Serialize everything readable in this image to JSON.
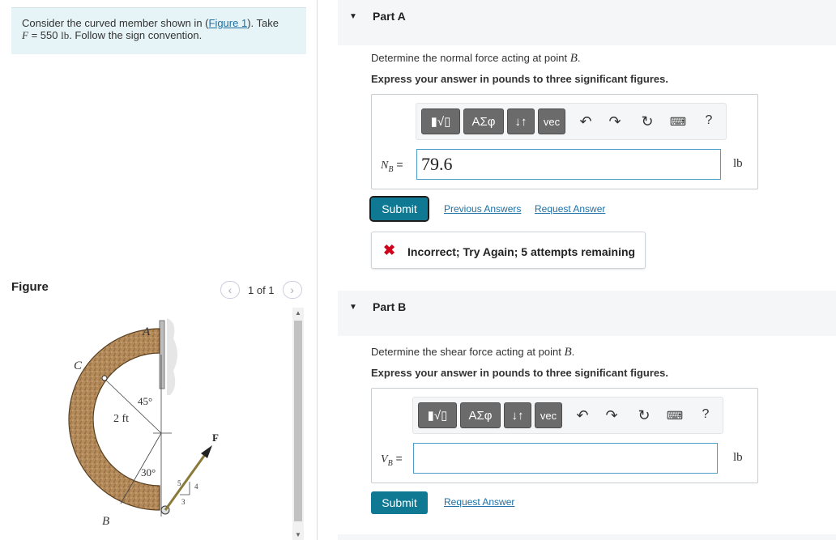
{
  "intro": {
    "text_before": "Consider the curved member shown in (",
    "figure_link": "Figure 1",
    "text_after": "). Take",
    "f_symbol": "F",
    "f_value": " = 550 ",
    "f_unit": "lb",
    "convention": ". Follow the sign convention."
  },
  "figure_panel": {
    "title": "Figure",
    "pager_text": "1 of 1",
    "labels": {
      "A": "A",
      "B": "B",
      "C": "C",
      "F": "F",
      "radius": "2 ft",
      "angle_45": "45°",
      "angle_30": "30°",
      "slope_5": "5",
      "slope_4": "4",
      "slope_3": "3"
    }
  },
  "part_a": {
    "title": "Part A",
    "question_prefix": "Determine the normal force acting at point ",
    "question_point": "B",
    "question_suffix": ".",
    "instruction": "Express your answer in pounds to three significant figures.",
    "toolbar": {
      "template": "▮√▯",
      "greek": "ΑΣφ",
      "arrows": "↓↑",
      "vec": "vec",
      "help": "?"
    },
    "field_label_var": "N",
    "field_label_sub": "B",
    "field_label_eq": " = ",
    "field_value": "79.6",
    "unit": "lb",
    "submit": "Submit",
    "previous_answers": "Previous Answers",
    "request_answer": "Request Answer",
    "feedback": "Incorrect; Try Again; 5 attempts remaining"
  },
  "part_b": {
    "title": "Part B",
    "question_prefix": "Determine the shear force acting at point ",
    "question_point": "B",
    "question_suffix": ".",
    "instruction": "Express your answer in pounds to three significant figures.",
    "toolbar": {
      "template": "▮√▯",
      "greek": "ΑΣφ",
      "arrows": "↓↑",
      "vec": "vec",
      "help": "?"
    },
    "field_label_var": "V",
    "field_label_sub": "B",
    "field_label_eq": " = ",
    "field_value": "",
    "unit": "lb",
    "submit": "Submit",
    "request_answer": "Request Answer"
  },
  "colors": {
    "accent": "#0f7893",
    "link": "#1d6fa3",
    "error": "#d0021b",
    "intro_bg": "#e6f4f7"
  }
}
